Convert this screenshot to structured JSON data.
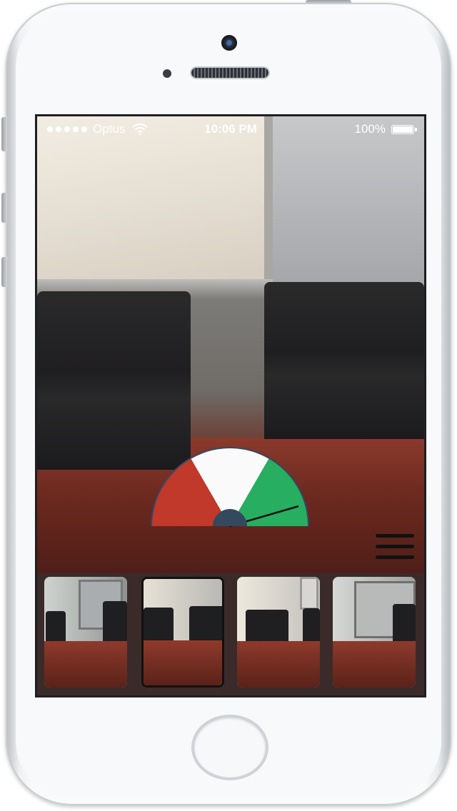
{
  "status_bar": {
    "carrier": "Optus",
    "time": "10:06 PM",
    "battery": "100%"
  },
  "gauge": {
    "value_fraction": 0.91,
    "zones": [
      {
        "name": "bad",
        "color": "#c0392b"
      },
      {
        "name": "neutral",
        "color": "#fafafa"
      },
      {
        "name": "good",
        "color": "#27ae60"
      }
    ],
    "hub_color": "#34495e"
  },
  "thumbnails": [
    {
      "label": "photo-1",
      "selected": false
    },
    {
      "label": "photo-2",
      "selected": true
    },
    {
      "label": "photo-3",
      "selected": false
    },
    {
      "label": "photo-4",
      "selected": false
    }
  ]
}
